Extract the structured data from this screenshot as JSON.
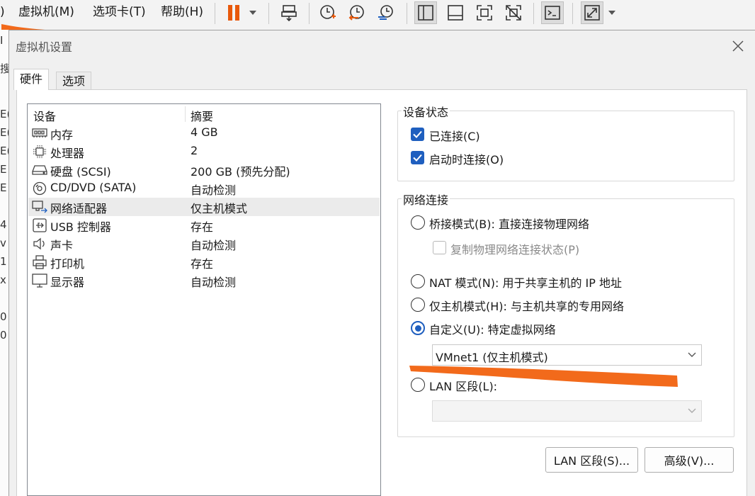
{
  "menubar": {
    "fragment": ")",
    "items": [
      "虚拟机(M)",
      "选项卡(T)",
      "帮助(H)"
    ]
  },
  "toolbar": {
    "icons": [
      "pause-icon",
      "dropdown-icon",
      "send-ctrl-alt-del-icon",
      "snapshot-take-icon",
      "snapshot-revert-icon",
      "snapshot-manager-icon",
      "library-view-icon",
      "thumbnail-view-icon",
      "fullscreen-icon",
      "unity-icon",
      "console-icon",
      "stretch-icon",
      "stretch-dropdown-icon"
    ],
    "accent_color": "#e8590c"
  },
  "behind_window": {
    "chars": [
      "I",
      "搜",
      "E(",
      "E(",
      "E(",
      "E",
      "E",
      "4",
      "v",
      "1",
      "x",
      "0",
      "0"
    ]
  },
  "dialog": {
    "title": "虚拟机设置",
    "tabs": [
      "硬件",
      "选项"
    ],
    "devices": {
      "header": {
        "device": "设备",
        "summary": "摘要"
      },
      "rows": [
        {
          "name": "内存",
          "summary": "4 GB",
          "icon": "memory-icon"
        },
        {
          "name": "处理器",
          "summary": "2",
          "icon": "cpu-icon"
        },
        {
          "name": "硬盘 (SCSI)",
          "summary": "200 GB (预先分配)",
          "icon": "hard-disk-icon"
        },
        {
          "name": "CD/DVD (SATA)",
          "summary": "自动检测",
          "icon": "cd-dvd-icon"
        },
        {
          "name": "网络适配器",
          "summary": "仅主机模式",
          "icon": "network-adapter-icon",
          "selected": true
        },
        {
          "name": "USB 控制器",
          "summary": "存在",
          "icon": "usb-icon"
        },
        {
          "name": "声卡",
          "summary": "自动检测",
          "icon": "sound-card-icon"
        },
        {
          "name": "打印机",
          "summary": "存在",
          "icon": "printer-icon"
        },
        {
          "name": "显示器",
          "summary": "自动检测",
          "icon": "display-icon"
        }
      ]
    },
    "device_status": {
      "label": "设备状态",
      "connected": {
        "label": "已连接(C)",
        "checked": true
      },
      "connect_at_power_on": {
        "label": "启动时连接(O)",
        "checked": true
      }
    },
    "network_connection": {
      "label": "网络连接",
      "bridged": {
        "label": "桥接模式(B): 直接连接物理网络",
        "selected": false
      },
      "replicate": {
        "label": "复制物理网络连接状态(P)",
        "checked": false,
        "enabled": false
      },
      "nat": {
        "label": "NAT 模式(N): 用于共享主机的 IP 地址",
        "selected": false
      },
      "host_only": {
        "label": "仅主机模式(H): 与主机共享的专用网络",
        "selected": false
      },
      "custom": {
        "label": "自定义(U): 特定虚拟网络",
        "selected": true
      },
      "custom_select_value": "VMnet1 (仅主机模式)",
      "lan_segment": {
        "label": "LAN 区段(L):",
        "selected": false
      },
      "lan_select_value": ""
    },
    "buttons": {
      "lan_segments": "LAN 区段(S)...",
      "advanced": "高级(V)..."
    }
  }
}
